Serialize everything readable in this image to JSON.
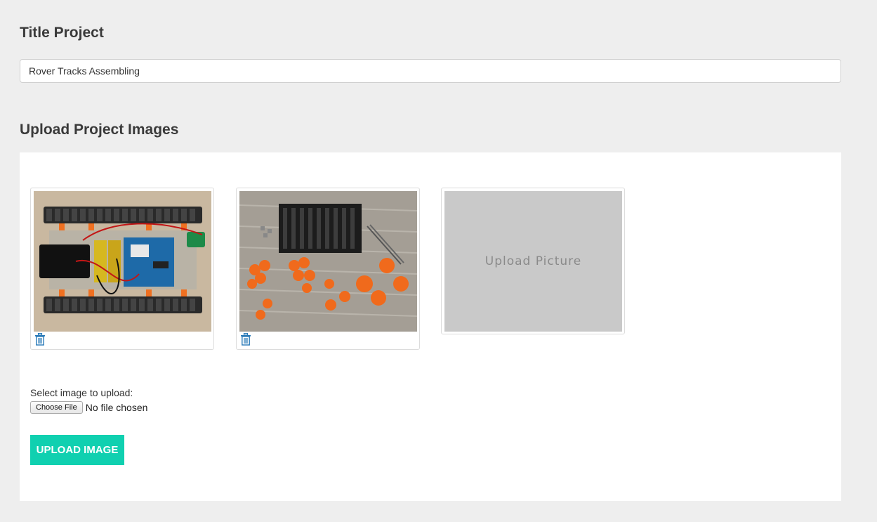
{
  "title_section": {
    "heading": "Title Project",
    "value": "Rover Tracks Assembling"
  },
  "upload_section": {
    "heading": "Upload Project Images",
    "images": [
      {
        "icon": "trash-icon"
      },
      {
        "icon": "trash-icon"
      }
    ],
    "placeholder_label": "Upload Picture",
    "select_label": "Select image to upload:",
    "choose_file_label": "Choose File",
    "no_file_text": "No file chosen",
    "upload_button": "UPLOAD IMAGE"
  },
  "colors": {
    "accent": "#10d0b0",
    "icon": "#2a7ab8",
    "background": "#eeeeee"
  }
}
